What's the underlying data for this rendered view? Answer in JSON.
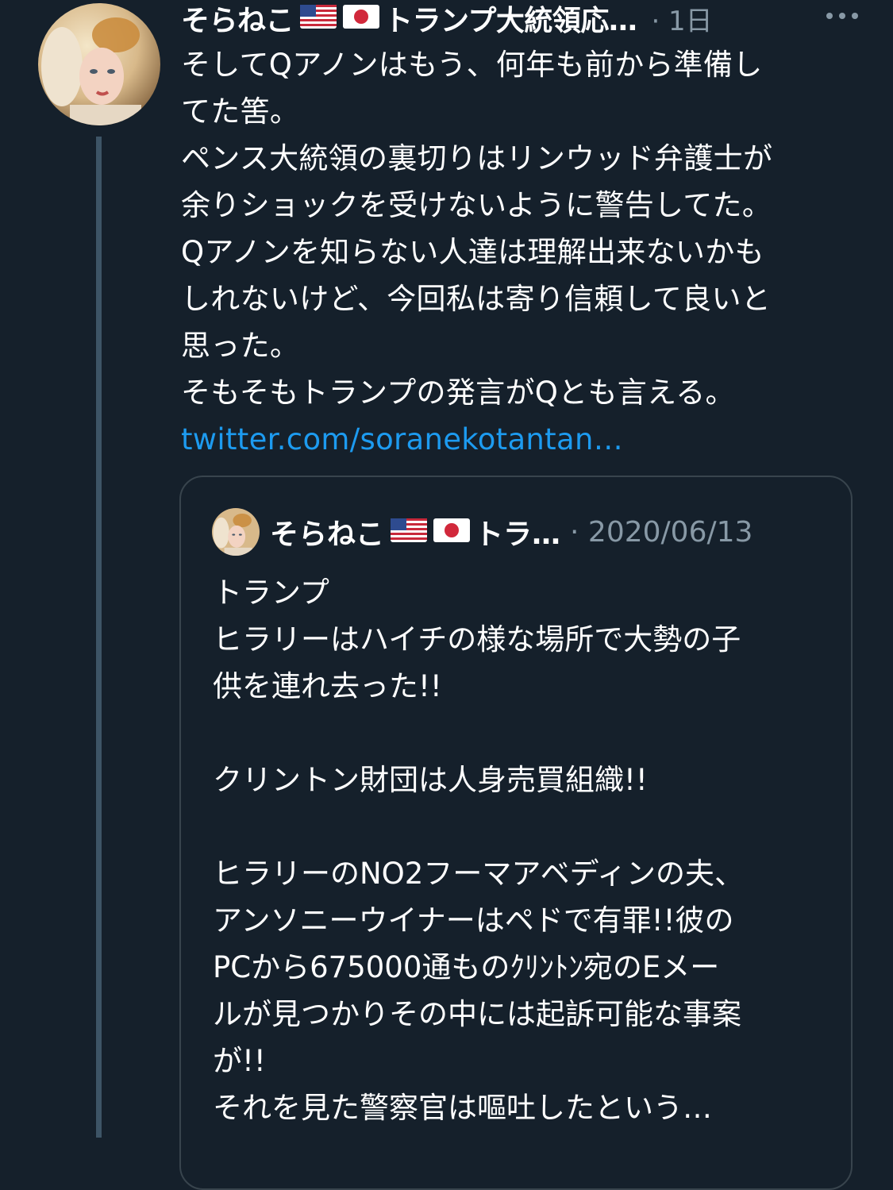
{
  "tweet": {
    "author_name": "そらねこ",
    "author_suffix": "トランプ大統領応…",
    "time": "· 1日",
    "text_lines": [
      "そしてQアノンはもう、何年も前から準備し",
      "てた筈。",
      "ペンス大統領の裏切りはリンウッド弁護士が",
      "余りショックを受けないように警告してた。",
      "Qアノンを知らない人達は理解出来ないかも",
      "しれないけど、今回私は寄り信頼して良いと",
      "思った。",
      "そもそもトランプの発言がQとも言える。"
    ],
    "link": "twitter.com/soranekotantan…",
    "icons": {
      "more": "more-horizontal-icon",
      "flag_us": "us-flag-icon",
      "flag_jp": "japan-flag-icon"
    }
  },
  "quote": {
    "author_name": "そらねこ",
    "author_suffix": "トラ…",
    "time": "· 2020/06/13",
    "text_lines": [
      "トランプ",
      "ヒラリーはハイチの様な場所で大勢の子",
      "供を連れ去った!!",
      "",
      "クリントン財団は人身売買組織!!",
      "",
      "ヒラリーのNO2フーマアベディンの夫、",
      "アンソニーウイナーはペドで有罪!!彼の",
      "PCから675000通ものｸﾘﾝﾄﾝ宛のEメー",
      "ルが見つかりその中には起訴可能な事案",
      "が!!",
      "それを見た警察官は嘔吐したという…"
    ]
  },
  "colors": {
    "background": "#15202b",
    "text": "#ffffff",
    "muted": "#8899a6",
    "link": "#1d9bf0",
    "border": "#38444d"
  }
}
